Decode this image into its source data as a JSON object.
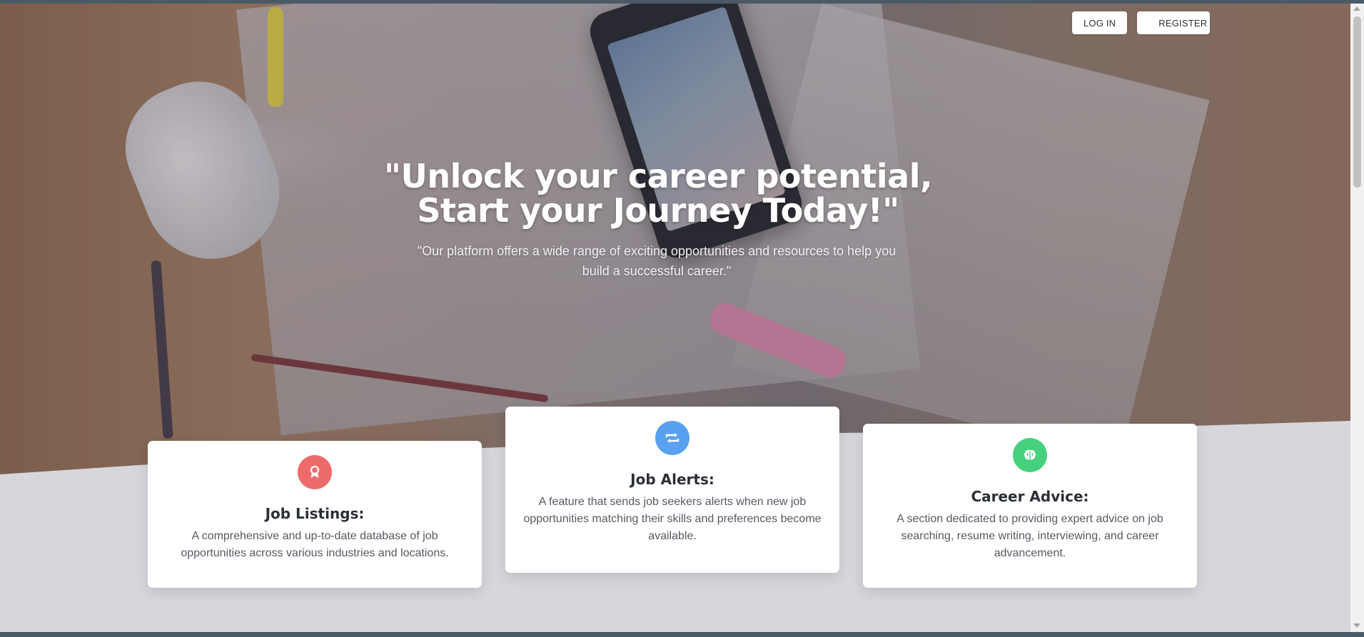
{
  "nav": {
    "login_label": "LOG IN",
    "register_label": "REGISTER"
  },
  "hero": {
    "headline_line1": "\"Unlock your career potential,",
    "headline_line2": "Start your Journey Today!\"",
    "subtitle": "\"Our platform offers a wide range of exciting opportunities and resources to help you build a successful career.\""
  },
  "features": [
    {
      "title": "Job Listings:",
      "description": "A comprehensive and up-to-date database of job opportunities across various industries and locations.",
      "icon": "award-icon",
      "color": "#ef6b6b"
    },
    {
      "title": "Job Alerts:",
      "description": "A feature that sends job seekers alerts when new job opportunities matching their skills and preferences become available.",
      "icon": "repeat-icon",
      "color": "#5aa0f0"
    },
    {
      "title": "Career Advice:",
      "description": "A section dedicated to providing expert advice on job searching, resume writing, interviewing, and career advancement.",
      "icon": "brain-icon",
      "color": "#47d17f"
    }
  ],
  "colors": {
    "page_background": "#d7d6dc",
    "card_background": "#ffffff",
    "heading_text": "#2b2f36"
  }
}
